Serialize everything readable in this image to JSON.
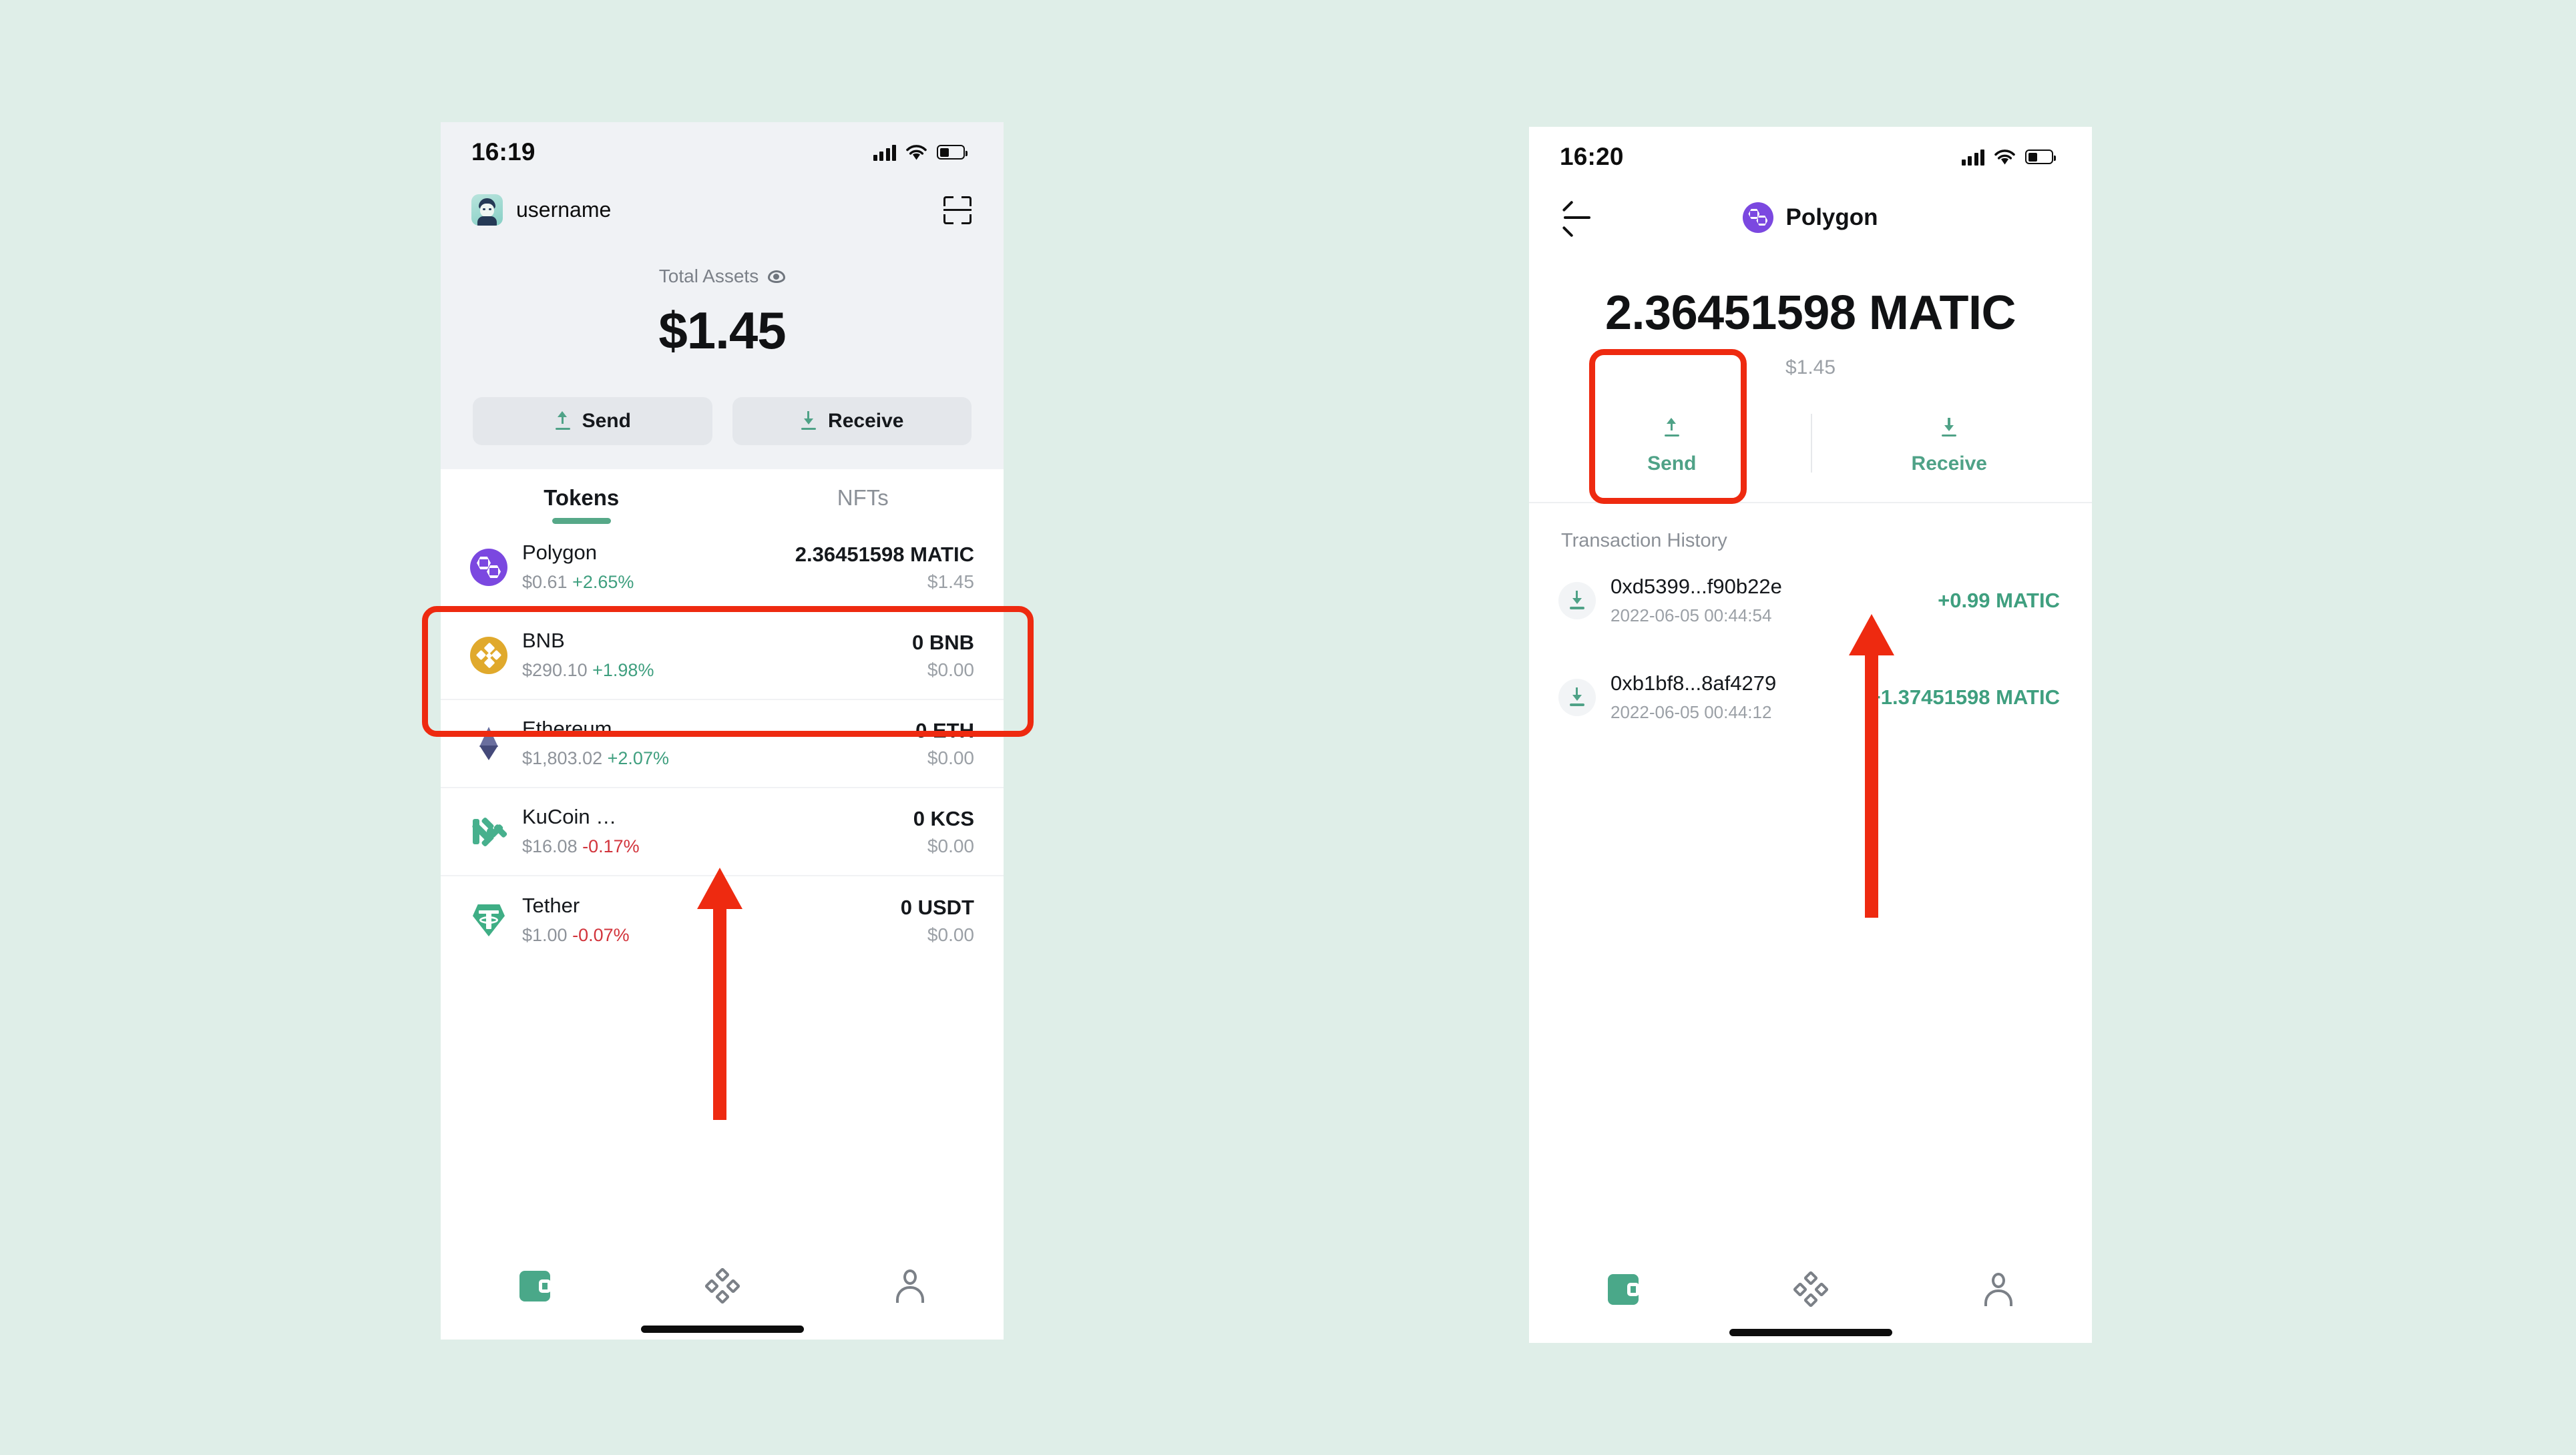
{
  "background_color": "#dfeee8",
  "accent_green": "#4fa287",
  "annotation_color": "#ee2a10",
  "wallet_screen": {
    "status_bar": {
      "time": "16:19",
      "signal_icon": "cellular-signal-icon",
      "wifi_icon": "wifi-icon",
      "battery_icon": "battery-icon"
    },
    "header": {
      "avatar_icon": "user-avatar-icon",
      "username": "username",
      "scan_icon": "scan-qr-icon"
    },
    "total_assets": {
      "label": "Total Assets",
      "visibility_icon": "eye-icon",
      "amount": "$1.45"
    },
    "actions": [
      {
        "label": "Send",
        "icon": "arrow-up-send-icon"
      },
      {
        "label": "Receive",
        "icon": "arrow-down-receive-icon"
      }
    ],
    "tabs": [
      {
        "label": "Tokens",
        "active": true
      },
      {
        "label": "NFTs",
        "active": false
      }
    ],
    "tokens": [
      {
        "icon": "polygon-coin-icon",
        "name": "Polygon",
        "price": "$0.61",
        "change": "+2.65%",
        "change_dir": "up",
        "balance": "2.36451598 MATIC",
        "value": "$1.45"
      },
      {
        "icon": "bnb-coin-icon",
        "name": "BNB",
        "price": "$290.10",
        "change": "+1.98%",
        "change_dir": "up",
        "balance": "0 BNB",
        "value": "$0.00"
      },
      {
        "icon": "ethereum-coin-icon",
        "name": "Ethereum",
        "price": "$1,803.02",
        "change": "+2.07%",
        "change_dir": "up",
        "balance": "0 ETH",
        "value": "$0.00"
      },
      {
        "icon": "kucoin-coin-icon",
        "name": "KuCoin …",
        "price": "$16.08",
        "change": "-0.17%",
        "change_dir": "down",
        "balance": "0 KCS",
        "value": "$0.00"
      },
      {
        "icon": "tether-coin-icon",
        "name": "Tether",
        "price": "$1.00",
        "change": "-0.07%",
        "change_dir": "down",
        "balance": "0 USDT",
        "value": "$0.00"
      }
    ],
    "bottom_nav": [
      {
        "icon": "wallet-icon",
        "active": true
      },
      {
        "icon": "apps-grid-icon",
        "active": false
      },
      {
        "icon": "person-profile-icon",
        "active": false
      }
    ]
  },
  "token_detail_screen": {
    "status_bar": {
      "time": "16:20",
      "signal_icon": "cellular-signal-icon",
      "wifi_icon": "wifi-icon",
      "battery_icon": "battery-icon"
    },
    "header": {
      "back_icon": "back-arrow-icon",
      "token_icon": "polygon-coin-icon",
      "title": "Polygon"
    },
    "balance": "2.36451598 MATIC",
    "fiat_value": "$1.45",
    "actions": [
      {
        "label": "Send",
        "icon": "arrow-up-send-icon"
      },
      {
        "label": "Receive",
        "icon": "arrow-down-receive-icon"
      }
    ],
    "transaction_history": {
      "title": "Transaction History",
      "items": [
        {
          "icon": "arrow-down-receive-icon",
          "hash": "0xd5399...f90b22e",
          "timestamp": "2022-06-05 00:44:54",
          "amount": "+0.99 MATIC"
        },
        {
          "icon": "arrow-down-receive-icon",
          "hash": "0xb1bf8...8af4279",
          "timestamp": "2022-06-05 00:44:12",
          "amount": "+1.37451598 MATIC"
        }
      ]
    },
    "bottom_nav": [
      {
        "icon": "wallet-icon",
        "active": true
      },
      {
        "icon": "apps-grid-icon",
        "active": false
      },
      {
        "icon": "person-profile-icon",
        "active": false
      }
    ]
  },
  "annotations": [
    {
      "type": "highlight-box",
      "target": "polygon-token-row"
    },
    {
      "type": "highlight-box",
      "target": "send-button-detail"
    },
    {
      "type": "arrow",
      "target": "polygon-token-row",
      "direction": "up"
    },
    {
      "type": "arrow",
      "target": "first-transaction",
      "direction": "up"
    }
  ]
}
